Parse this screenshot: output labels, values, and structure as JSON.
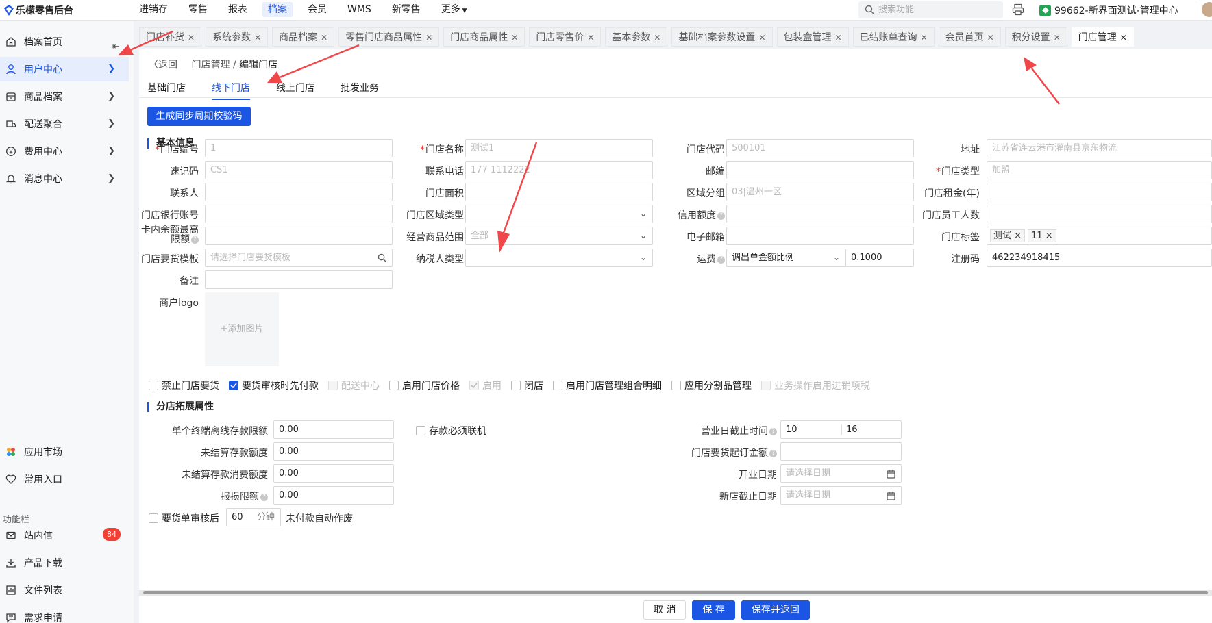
{
  "brand": "乐檬零售后台",
  "topnav": [
    "进销存",
    "零售",
    "报表",
    "档案",
    "会员",
    "WMS",
    "新零售",
    "更多"
  ],
  "search_placeholder": "搜索功能",
  "store_name": "99662-新界面测试-管理中心",
  "sidebar": {
    "items": [
      {
        "label": "档案首页",
        "icon": "home-icon"
      },
      {
        "label": "用户中心",
        "icon": "user-icon"
      },
      {
        "label": "商品档案",
        "icon": "archive-icon"
      },
      {
        "label": "配送聚合",
        "icon": "delivery-icon"
      },
      {
        "label": "费用中心",
        "icon": "yen-icon"
      },
      {
        "label": "消息中心",
        "icon": "bell-icon"
      }
    ],
    "bottom_items": [
      {
        "label": "应用市场",
        "icon": "app-market-icon"
      },
      {
        "label": "常用入口",
        "icon": "heart-icon"
      }
    ],
    "section_label": "功能栏",
    "func_items": [
      {
        "label": "站内信",
        "icon": "mail-icon",
        "badge": "84"
      },
      {
        "label": "产品下载",
        "icon": "download-icon"
      },
      {
        "label": "文件列表",
        "icon": "file-list-icon"
      },
      {
        "label": "需求申请",
        "icon": "request-icon"
      }
    ]
  },
  "tabs": [
    "门店补货",
    "系统参数",
    "商品档案",
    "零售门店商品属性",
    "门店商品属性",
    "门店零售价",
    "基本参数",
    "基础档案参数设置",
    "包装盒管理",
    "已结账单查询",
    "会员首页",
    "积分设置",
    "门店管理"
  ],
  "breadcrumb": {
    "back": "返回",
    "parent": "门店管理",
    "separator": "/",
    "current": "编辑门店"
  },
  "subtabs": [
    "基础门店",
    "线下门店",
    "线上门店",
    "批发业务"
  ],
  "gen_button": "生成同步周期校验码",
  "basic_title": "基本信息",
  "fields": {
    "store_no": {
      "label": "门店编号",
      "value": "1"
    },
    "store_name": {
      "label": "门店名称",
      "value": "测试1"
    },
    "store_code": {
      "label": "门店代码",
      "value": "500101"
    },
    "address": {
      "label": "地址",
      "value": "江苏省连云港市灌南县京东物流"
    },
    "quick_code": {
      "label": "速记码",
      "value": "CS1"
    },
    "phone": {
      "label": "联系电话",
      "value": "177 1112222"
    },
    "postcode": {
      "label": "邮编",
      "value": ""
    },
    "store_type": {
      "label": "门店类型",
      "value": "加盟"
    },
    "contact": {
      "label": "联系人",
      "value": ""
    },
    "area": {
      "label": "门店面积",
      "value": ""
    },
    "region_group": {
      "label": "区域分组",
      "value": "03|温州一区"
    },
    "rent": {
      "label": "门店租金(年)",
      "value": ""
    },
    "bank_account": {
      "label": "门店银行账号",
      "value": ""
    },
    "region_type": {
      "label": "门店区域类型",
      "value": ""
    },
    "credit": {
      "label": "信用额度",
      "value": ""
    },
    "staff_count": {
      "label": "门店员工人数",
      "value": ""
    },
    "card_limit_l1": "卡内余额最高",
    "card_limit_l2": "限额",
    "card_limit": {
      "value": ""
    },
    "goods_scope": {
      "label": "经营商品范围",
      "value": "全部"
    },
    "email": {
      "label": "电子邮箱",
      "value": ""
    },
    "store_tags": {
      "label": "门店标签",
      "tags": [
        "测试",
        "11"
      ]
    },
    "order_template": {
      "label": "门店要货模板",
      "placeholder": "请选择门店要货模板"
    },
    "taxpayer_type": {
      "label": "纳税人类型",
      "value": ""
    },
    "freight": {
      "label": "运费",
      "mode": "调出单金额比例",
      "value": "0.1000"
    },
    "reg_code": {
      "label": "注册码",
      "value": "462234918415"
    },
    "remark": {
      "label": "备注",
      "value": ""
    },
    "logo": {
      "label": "商户logo",
      "add_text": "+添加图片"
    }
  },
  "checkboxes": [
    {
      "label": "禁止门店要货",
      "checked": false,
      "disabled": false
    },
    {
      "label": "要货审核时先付款",
      "checked": true,
      "disabled": false
    },
    {
      "label": "配送中心",
      "checked": false,
      "disabled": true
    },
    {
      "label": "启用门店价格",
      "checked": false,
      "disabled": false
    },
    {
      "label": "启用",
      "checked": true,
      "disabled": true
    },
    {
      "label": "闭店",
      "checked": false,
      "disabled": false
    },
    {
      "label": "启用门店管理组合明细",
      "checked": false,
      "disabled": false
    },
    {
      "label": "应用分割品管理",
      "checked": false,
      "disabled": false
    },
    {
      "label": "业务操作启用进销项税",
      "checked": false,
      "disabled": true
    }
  ],
  "ext_title": "分店拓展属性",
  "ext_fields": {
    "offline_limit": {
      "label": "单个终端离线存款限额",
      "value": "0.00"
    },
    "must_online": "存款必须联机",
    "unsettled_amount": {
      "label": "未结算存款额度",
      "value": "0.00"
    },
    "unsettled_consume": {
      "label": "未结算存款消费额度",
      "value": "0.00"
    },
    "loss_limit": {
      "label": "报损限额",
      "value": "0.00"
    },
    "biz_cutoff": {
      "label": "营业日截止时间",
      "h": "10",
      "m": "16"
    },
    "min_order": {
      "label": "门店要货起订金额",
      "value": ""
    },
    "open_date": {
      "label": "开业日期",
      "placeholder": "请选择日期"
    },
    "new_store_date": {
      "label": "新店截止日期",
      "placeholder": "请选择日期"
    },
    "auto_void_pre": "要货单审核后",
    "auto_void_minutes": "60",
    "auto_void_unit": "分钟",
    "auto_void_post": "未付款自动作废"
  },
  "footer": {
    "cancel": "取 消",
    "save": "保 存",
    "save_back": "保存并返回"
  },
  "colors": {
    "primary": "#1b55e4",
    "annotation_arrow": "#f0474a",
    "required": "#e33333"
  }
}
